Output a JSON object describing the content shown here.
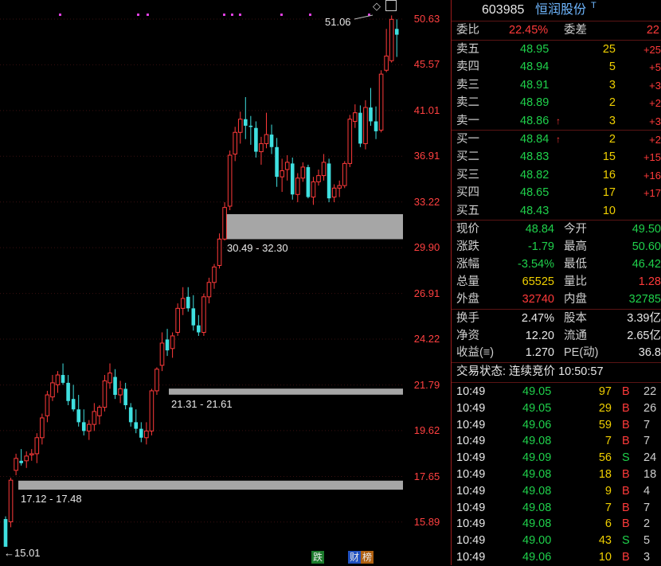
{
  "stock": {
    "code": "603985",
    "name": "恒润股份",
    "tag": "T"
  },
  "axis_ticks": [
    "50.63",
    "45.57",
    "41.01",
    "36.91",
    "33.22",
    "29.90",
    "26.91",
    "24.22",
    "21.79",
    "19.62",
    "17.65",
    "15.89"
  ],
  "chart_annotations": {
    "high_label": "51.06",
    "low_label": "←15.01",
    "zones": [
      {
        "label": "30.49 - 32.30",
        "from": 30.49,
        "to": 32.3
      },
      {
        "label": "21.31 - 21.61",
        "from": 21.31,
        "to": 21.61
      },
      {
        "label": "17.12 - 17.48",
        "from": 17.12,
        "to": 17.48
      }
    ],
    "badges": [
      {
        "text": "跌",
        "color": "#1b7a2b"
      },
      {
        "text": "财",
        "color": "#2050c0"
      },
      {
        "text": "榜",
        "color": "#b06010"
      }
    ]
  },
  "chart_data": {
    "type": "candlestick",
    "y_scale": "log",
    "ylim": [
      15.0,
      52.0
    ],
    "candles": [
      [
        16.0,
        16.1,
        15.2,
        15.01
      ],
      [
        15.9,
        17.6,
        15.7,
        17.5
      ],
      [
        17.9,
        18.6,
        17.7,
        18.4
      ],
      [
        18.3,
        18.8,
        18.1,
        18.2
      ],
      [
        18.3,
        18.7,
        18.0,
        18.5
      ],
      [
        18.6,
        18.8,
        18.3,
        18.6
      ],
      [
        18.6,
        19.5,
        18.2,
        19.3
      ],
      [
        19.3,
        20.4,
        19.0,
        20.2
      ],
      [
        20.3,
        21.5,
        20.0,
        21.3
      ],
      [
        21.2,
        22.3,
        21.0,
        21.9
      ],
      [
        21.8,
        22.5,
        21.4,
        22.3
      ],
      [
        22.3,
        22.9,
        21.8,
        21.9
      ],
      [
        21.9,
        22.3,
        20.8,
        21.0
      ],
      [
        21.1,
        21.8,
        20.5,
        20.6
      ],
      [
        20.6,
        21.3,
        19.8,
        20.0
      ],
      [
        20.0,
        20.6,
        19.4,
        19.6
      ],
      [
        19.6,
        20.1,
        19.2,
        19.9
      ],
      [
        19.9,
        20.9,
        19.6,
        20.5
      ],
      [
        20.3,
        20.8,
        19.9,
        20.7
      ],
      [
        20.7,
        22.3,
        20.5,
        22.0
      ],
      [
        21.9,
        22.9,
        21.6,
        22.4
      ],
      [
        22.2,
        22.6,
        21.1,
        21.3
      ],
      [
        21.3,
        22.0,
        20.9,
        21.6
      ],
      [
        21.6,
        21.9,
        20.6,
        20.8
      ],
      [
        20.7,
        20.9,
        19.8,
        20.0
      ],
      [
        20.0,
        20.6,
        19.5,
        19.7
      ],
      [
        19.7,
        20.0,
        19.1,
        19.3
      ],
      [
        19.3,
        20.0,
        19.0,
        19.6
      ],
      [
        19.6,
        21.6,
        19.4,
        21.5
      ],
      [
        21.5,
        22.7,
        21.3,
        22.6
      ],
      [
        22.8,
        24.6,
        22.5,
        24.0
      ],
      [
        24.2,
        24.8,
        23.3,
        23.6
      ],
      [
        23.7,
        24.6,
        23.2,
        24.4
      ],
      [
        24.6,
        26.3,
        24.4,
        26.0
      ],
      [
        26.0,
        27.3,
        25.6,
        26.6
      ],
      [
        26.7,
        27.3,
        25.8,
        26.0
      ],
      [
        26.0,
        26.8,
        24.7,
        25.0
      ],
      [
        25.0,
        25.6,
        24.4,
        24.6
      ],
      [
        24.6,
        26.9,
        24.4,
        26.7
      ],
      [
        26.7,
        27.9,
        26.3,
        27.6
      ],
      [
        27.6,
        28.8,
        27.2,
        28.6
      ],
      [
        28.7,
        30.9,
        28.5,
        30.5
      ],
      [
        30.5,
        33.2,
        30.4,
        32.8
      ],
      [
        32.9,
        37.4,
        32.6,
        37.0
      ],
      [
        37.1,
        39.5,
        36.5,
        39.0
      ],
      [
        39.0,
        40.9,
        38.0,
        40.2
      ],
      [
        40.2,
        42.3,
        38.4,
        39.6
      ],
      [
        39.6,
        40.5,
        37.9,
        39.5
      ],
      [
        39.4,
        40.0,
        36.8,
        37.3
      ],
      [
        37.3,
        38.6,
        36.2,
        38.0
      ],
      [
        38.0,
        40.8,
        37.6,
        38.8
      ],
      [
        38.8,
        39.7,
        37.1,
        37.7
      ],
      [
        37.7,
        38.5,
        34.4,
        35.2
      ],
      [
        35.2,
        36.7,
        34.0,
        35.7
      ],
      [
        35.8,
        37.0,
        34.9,
        36.4
      ],
      [
        36.3,
        36.8,
        33.4,
        33.8
      ],
      [
        33.8,
        35.5,
        33.2,
        35.1
      ],
      [
        35.1,
        36.4,
        34.8,
        36.0
      ],
      [
        36.0,
        36.2,
        33.5,
        33.6
      ],
      [
        33.6,
        35.2,
        33.0,
        34.8
      ],
      [
        34.8,
        35.8,
        34.5,
        35.3
      ],
      [
        35.3,
        37.1,
        34.9,
        36.4
      ],
      [
        36.3,
        36.7,
        33.2,
        33.5
      ],
      [
        33.6,
        34.6,
        33.2,
        34.3
      ],
      [
        34.3,
        34.9,
        33.6,
        34.5
      ],
      [
        34.5,
        36.5,
        34.3,
        36.3
      ],
      [
        36.3,
        40.6,
        36.0,
        40.2
      ],
      [
        40.0,
        41.6,
        39.4,
        40.8
      ],
      [
        40.8,
        41.5,
        37.7,
        38.0
      ],
      [
        38.0,
        42.0,
        37.5,
        41.3
      ],
      [
        41.3,
        43.2,
        39.6,
        40.0
      ],
      [
        40.0,
        41.4,
        38.4,
        39.1
      ],
      [
        39.2,
        45.0,
        39.0,
        44.6
      ],
      [
        45.0,
        49.5,
        44.8,
        46.5
      ],
      [
        46.0,
        51.06,
        45.8,
        50.6
      ],
      [
        49.5,
        50.6,
        46.4,
        48.84
      ]
    ]
  },
  "panel": {
    "weibi_label": "委比",
    "weibi_value": "22.45%",
    "weicha_label": "委差",
    "weicha_value": "22",
    "asks": [
      {
        "label": "卖五",
        "price": "48.95",
        "vol": "25",
        "chg": "+25",
        "arrow": ""
      },
      {
        "label": "卖四",
        "price": "48.94",
        "vol": "5",
        "chg": "+5",
        "arrow": ""
      },
      {
        "label": "卖三",
        "price": "48.91",
        "vol": "3",
        "chg": "+3",
        "arrow": ""
      },
      {
        "label": "卖二",
        "price": "48.89",
        "vol": "2",
        "chg": "+2",
        "arrow": ""
      },
      {
        "label": "卖一",
        "price": "48.86",
        "vol": "3",
        "chg": "+3",
        "arrow": "↑"
      }
    ],
    "bids": [
      {
        "label": "买一",
        "price": "48.84",
        "vol": "2",
        "chg": "+2",
        "arrow": "↑"
      },
      {
        "label": "买二",
        "price": "48.83",
        "vol": "15",
        "chg": "+15",
        "arrow": ""
      },
      {
        "label": "买三",
        "price": "48.82",
        "vol": "16",
        "chg": "+16",
        "arrow": ""
      },
      {
        "label": "买四",
        "price": "48.65",
        "vol": "17",
        "chg": "+17",
        "arrow": ""
      },
      {
        "label": "买五",
        "price": "48.43",
        "vol": "10",
        "chg": "",
        "arrow": ""
      }
    ],
    "stats1": [
      {
        "l1": "现价",
        "v1": "48.84",
        "c1": "green",
        "l2": "今开",
        "v2": "49.50",
        "c2": "green"
      },
      {
        "l1": "涨跌",
        "v1": "-1.79",
        "c1": "green",
        "l2": "最高",
        "v2": "50.60",
        "c2": "green"
      },
      {
        "l1": "涨幅",
        "v1": "-3.54%",
        "c1": "green",
        "l2": "最低",
        "v2": "46.42",
        "c2": "green"
      },
      {
        "l1": "总量",
        "v1": "65525",
        "c1": "yellow",
        "l2": "量比",
        "v2": "1.28",
        "c2": "red"
      },
      {
        "l1": "外盘",
        "v1": "32740",
        "c1": "red",
        "l2": "内盘",
        "v2": "32785",
        "c2": "green"
      }
    ],
    "stats2": [
      {
        "l1": "换手",
        "v1": "2.47%",
        "l2": "股本",
        "v2": "3.39亿"
      },
      {
        "l1": "净资",
        "v1": "12.20",
        "l2": "流通",
        "v2": "2.65亿"
      },
      {
        "l1": "收益(≡)",
        "v1": "1.270",
        "l2": "PE(动)",
        "v2": "36.8"
      }
    ],
    "status": "交易状态: 连续竞价 10:50:57",
    "ticks": [
      {
        "time": "10:49",
        "price": "49.05",
        "vol": "97",
        "side": "B",
        "n": "22"
      },
      {
        "time": "10:49",
        "price": "49.05",
        "vol": "29",
        "side": "B",
        "n": "26"
      },
      {
        "time": "10:49",
        "price": "49.06",
        "vol": "59",
        "side": "B",
        "n": "7"
      },
      {
        "time": "10:49",
        "price": "49.08",
        "vol": "7",
        "side": "B",
        "n": "7"
      },
      {
        "time": "10:49",
        "price": "49.09",
        "vol": "56",
        "side": "S",
        "n": "24"
      },
      {
        "time": "10:49",
        "price": "49.08",
        "vol": "18",
        "side": "B",
        "n": "18"
      },
      {
        "time": "10:49",
        "price": "49.08",
        "vol": "9",
        "side": "B",
        "n": "4"
      },
      {
        "time": "10:49",
        "price": "49.08",
        "vol": "7",
        "side": "B",
        "n": "7"
      },
      {
        "time": "10:49",
        "price": "49.08",
        "vol": "6",
        "side": "B",
        "n": "2"
      },
      {
        "time": "10:49",
        "price": "49.00",
        "vol": "43",
        "side": "S",
        "n": "5"
      },
      {
        "time": "10:49",
        "price": "49.06",
        "vol": "10",
        "side": "B",
        "n": "3"
      }
    ]
  }
}
